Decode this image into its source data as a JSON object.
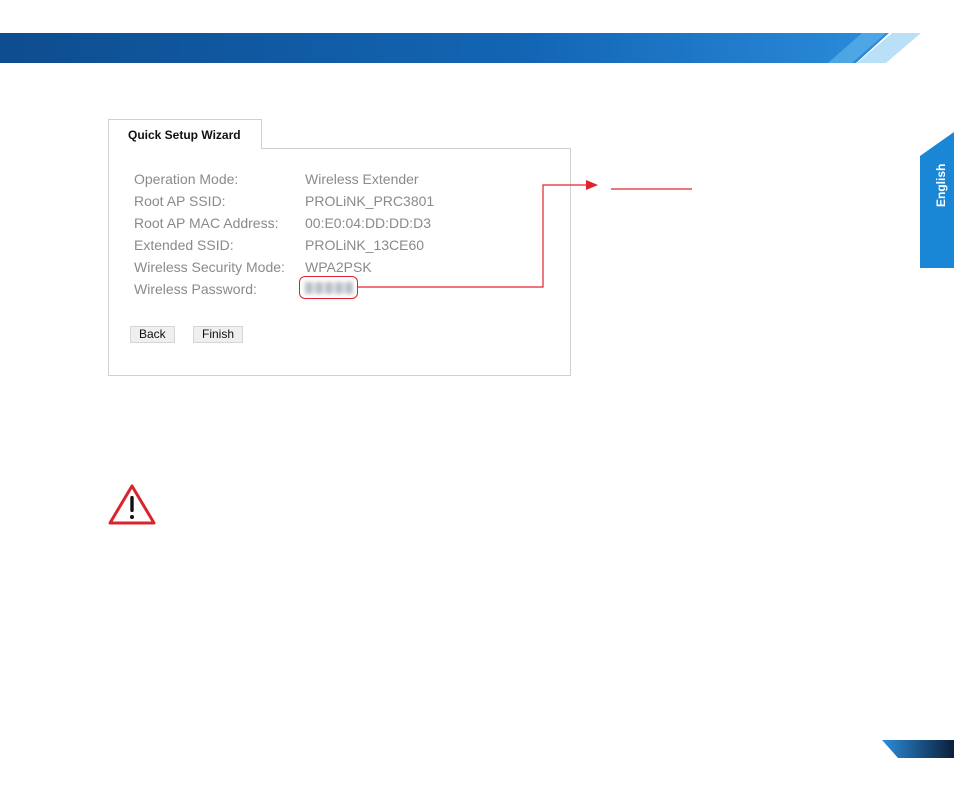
{
  "wizard": {
    "tab_label": "Quick Setup Wizard",
    "rows": [
      {
        "label": "Operation Mode:",
        "value": "Wireless Extender"
      },
      {
        "label": "Root AP SSID:",
        "value": "PROLiNK_PRC3801"
      },
      {
        "label": "Root AP MAC Address:",
        "value": "00:E0:04:DD:DD:D3"
      },
      {
        "label": "Extended SSID:",
        "value": "PROLiNK_13CE60"
      },
      {
        "label": "Wireless Security Mode:",
        "value": "WPA2PSK"
      },
      {
        "label": "Wireless Password:",
        "value": ""
      }
    ],
    "back_label": "Back",
    "finish_label": "Finish"
  },
  "side_tab": {
    "label": "English"
  },
  "icons": {
    "warning": "warning-triangle-icon",
    "arrow": "callout-arrow-icon"
  },
  "colors": {
    "accent_blue": "#1a86d6",
    "dark_blue": "#0f4f8f",
    "callout_red": "#e0242d"
  }
}
